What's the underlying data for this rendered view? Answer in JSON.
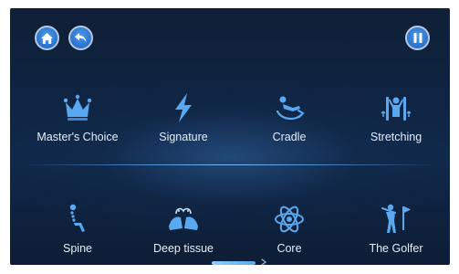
{
  "controls": {
    "home_icon": "home-icon",
    "back_icon": "undo-arrow-icon",
    "pause_icon": "pause-icon"
  },
  "programs": [
    {
      "label": "Master's Choice",
      "icon": "crown-icon"
    },
    {
      "label": "Signature",
      "icon": "lightning-bolt-icon"
    },
    {
      "label": "Cradle",
      "icon": "reclining-person-icon"
    },
    {
      "label": "Stretching",
      "icon": "stretching-person-icon"
    },
    {
      "label": "Spine",
      "icon": "seated-spine-icon"
    },
    {
      "label": "Deep tissue",
      "icon": "kneading-hands-icon"
    },
    {
      "label": "Core",
      "icon": "atom-icon"
    },
    {
      "label": "The Golfer",
      "icon": "golfer-icon"
    }
  ],
  "pagination": {
    "current_page": 1,
    "indicator_icon": "chevron-right-icon"
  },
  "colors": {
    "accent": "#3a86e0",
    "icon_blue": "#5aa8f0",
    "background": "#10284a",
    "label_text": "#e6edf6"
  }
}
